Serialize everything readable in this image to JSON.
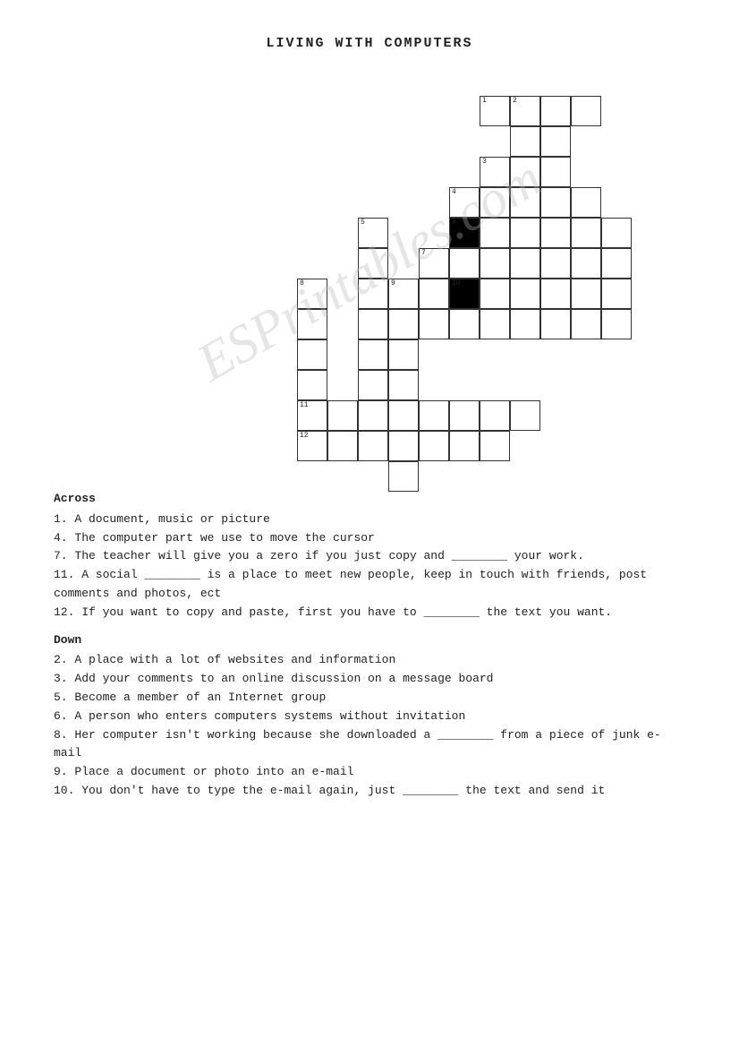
{
  "title": "LIVING WITH COMPUTERS",
  "watermark": "ESPrintables.com",
  "clues": {
    "across_heading": "Across",
    "across": [
      "1. A document, music or picture",
      "4. The computer part we use to move the cursor",
      "7. The teacher will give you a zero if you just copy and ________ your work.",
      "11. A social ________ is a place to meet new people, keep in touch with friends, post comments and photos, ect",
      "12. If you want to copy and paste, first you have to ________ the text you want."
    ],
    "down_heading": "Down",
    "down": [
      "2. A place with a lot of websites and information",
      "3. Add your comments to an online discussion on a message board",
      "5. Become a member of an Internet group",
      "6. A person who enters computers systems without invitation",
      "8. Her computer isn't working because she downloaded a ________ from a piece of junk e-mail",
      "9. Place a document or photo into an e-mail",
      "10. You don't have to type the e-mail again, just ________ the text and send it"
    ]
  }
}
